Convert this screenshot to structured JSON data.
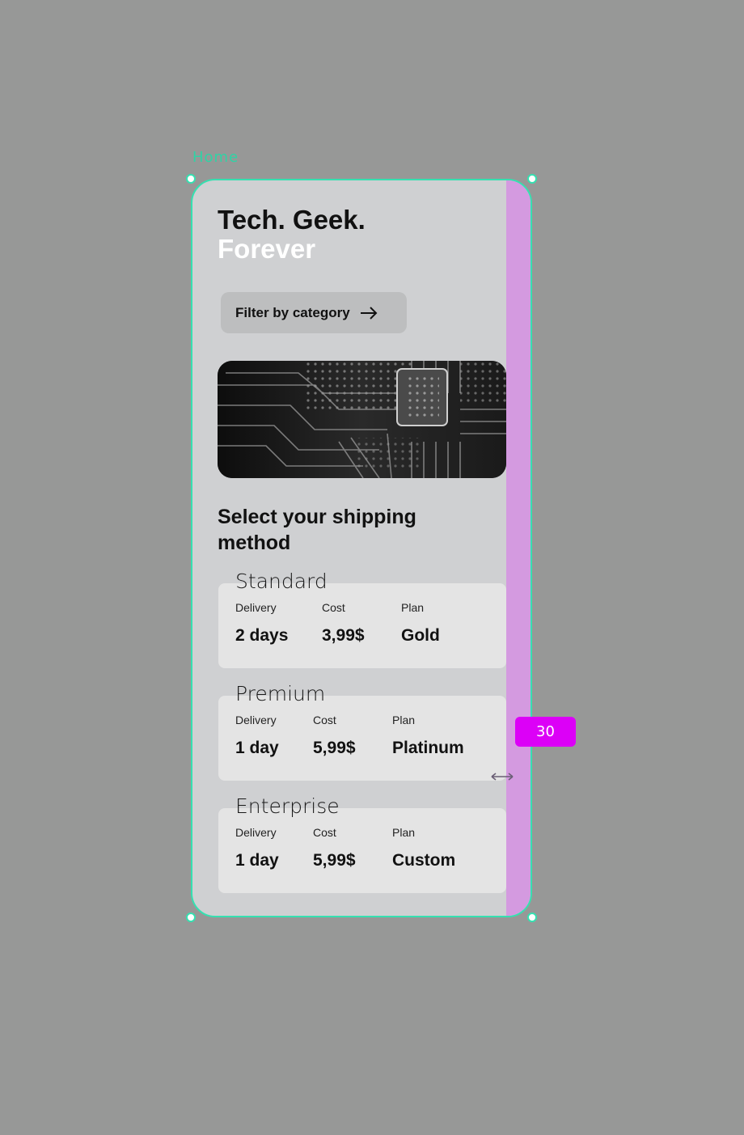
{
  "canvas": {
    "frame_label": "Home",
    "padding_badge": "30"
  },
  "header": {
    "title_line1": "Tech. Geek.",
    "title_line2": "Forever"
  },
  "filter": {
    "label": "Filter by category"
  },
  "shipping": {
    "title": "Select your shipping method",
    "plans": [
      {
        "name": "Standard",
        "delivery_label": "Delivery",
        "delivery": "2 days",
        "cost_label": "Cost",
        "cost": "3,99$",
        "plan_label": "Plan",
        "plan": "Gold"
      },
      {
        "name": "Premium",
        "delivery_label": "Delivery",
        "delivery": "1 day",
        "cost_label": "Cost",
        "cost": "5,99$",
        "plan_label": "Plan",
        "plan": "Platinum"
      },
      {
        "name": "Enterprise",
        "delivery_label": "Delivery",
        "delivery": "1 day",
        "cost_label": "Cost",
        "cost": "5,99$",
        "plan_label": "Plan",
        "plan": "Custom"
      }
    ]
  },
  "colors": {
    "canvas_bg": "#979897",
    "frame_bg": "#cfd0d2",
    "selection": "#35e0b0",
    "padding_overlay": "#d49ae0",
    "badge": "#dc00f7"
  },
  "icons": [
    "arrow-right-icon",
    "resize-horizontal-icon"
  ]
}
